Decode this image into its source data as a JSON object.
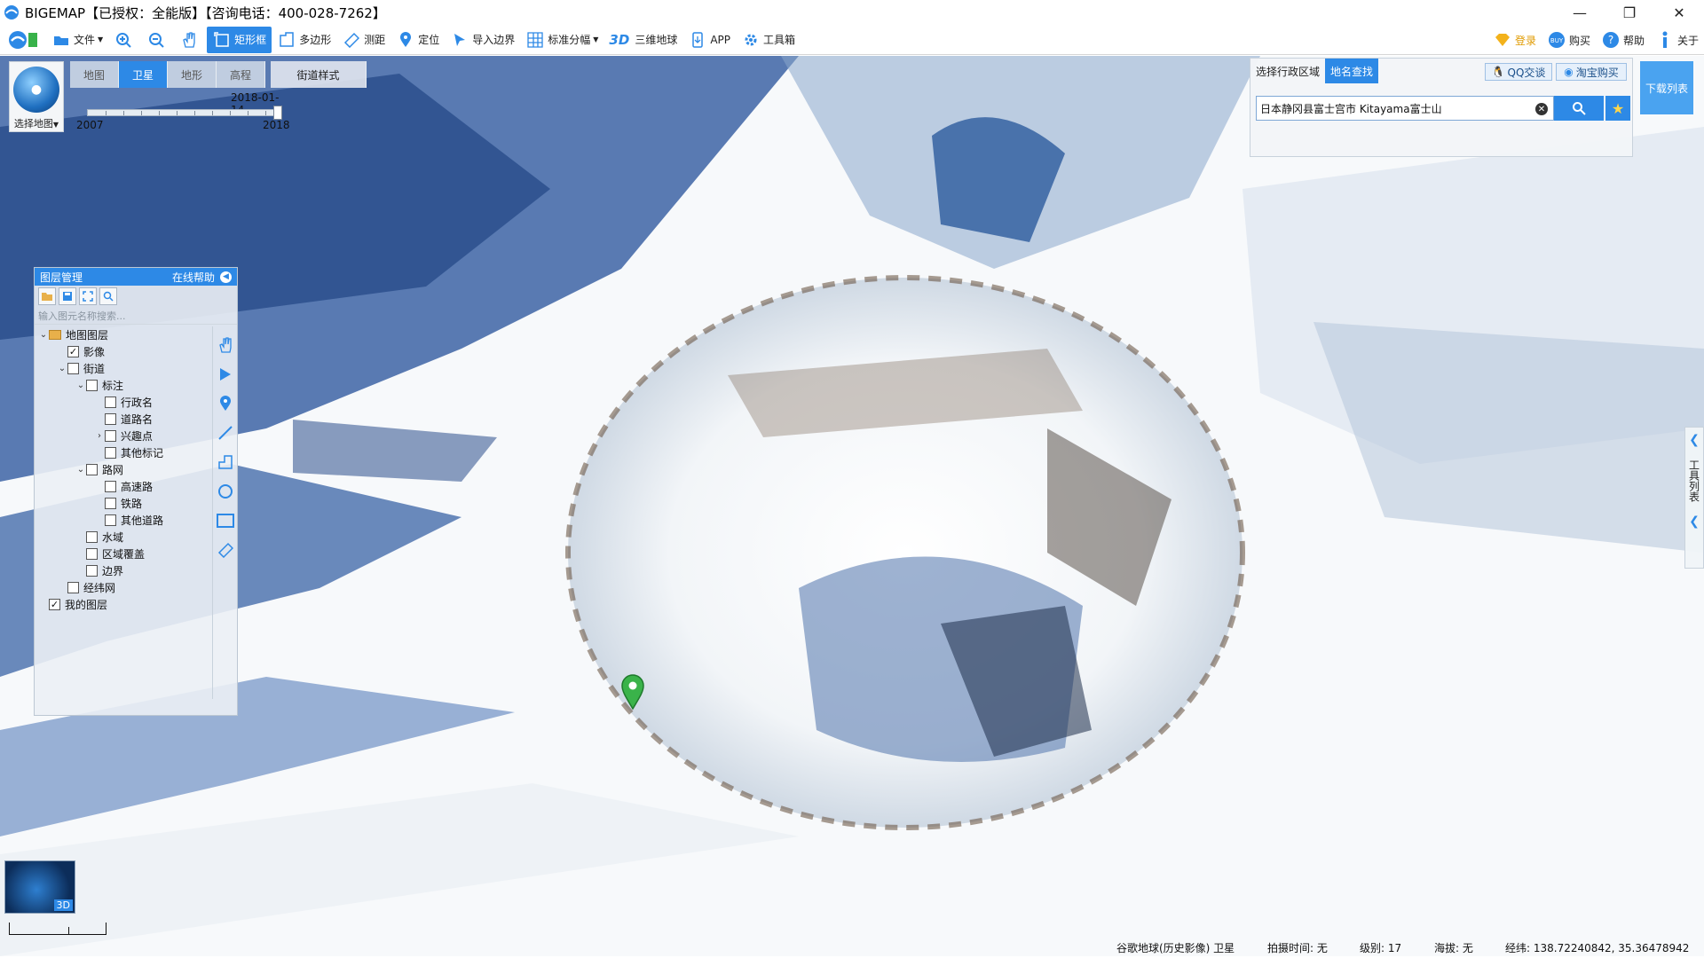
{
  "window": {
    "title": "BIGEMAP【已授权：全能版】【咨询电话：400-028-7262】",
    "minimize": "—",
    "restore": "❐",
    "close": "✕"
  },
  "toolbar": {
    "file": "文件",
    "rect": "矩形框",
    "polygon": "多边形",
    "measure": "测距",
    "locate": "定位",
    "import_boundary": "导入边界",
    "standard_tiles": "标准分幅",
    "three_d": "3D",
    "globe3d": "三维地球",
    "app": "APP",
    "toolbox": "工具箱",
    "login": "登录",
    "buy": "购买",
    "help": "帮助",
    "about": "关于"
  },
  "map_selector": {
    "label": "选择地图"
  },
  "map_types": [
    "地图",
    "卫星",
    "地形",
    "高程"
  ],
  "active_map_type": "卫星",
  "street_style": "街道样式",
  "timeline": {
    "date": "2018-01-14",
    "start": "2007",
    "end": "2018"
  },
  "layer_panel": {
    "title": "图层管理",
    "online_help": "在线帮助",
    "search_placeholder": "输入图元名称搜索...",
    "tree": [
      {
        "label": "地图图层",
        "level": 0,
        "expander": "v",
        "checkbox": false,
        "folder": true
      },
      {
        "label": "影像",
        "level": 1,
        "expander": "",
        "checkbox": true,
        "checked": true
      },
      {
        "label": "街道",
        "level": 1,
        "expander": "v",
        "checkbox": true,
        "checked": false
      },
      {
        "label": "标注",
        "level": 2,
        "expander": "v",
        "checkbox": true,
        "checked": false
      },
      {
        "label": "行政名",
        "level": 3,
        "expander": "",
        "checkbox": true,
        "checked": false
      },
      {
        "label": "道路名",
        "level": 3,
        "expander": "",
        "checkbox": true,
        "checked": false
      },
      {
        "label": "兴趣点",
        "level": 3,
        "expander": ">",
        "checkbox": true,
        "checked": false
      },
      {
        "label": "其他标记",
        "level": 3,
        "expander": "",
        "checkbox": true,
        "checked": false
      },
      {
        "label": "路网",
        "level": 2,
        "expander": "v",
        "checkbox": true,
        "checked": false
      },
      {
        "label": "高速路",
        "level": 3,
        "expander": "",
        "checkbox": true,
        "checked": false
      },
      {
        "label": "铁路",
        "level": 3,
        "expander": "",
        "checkbox": true,
        "checked": false
      },
      {
        "label": "其他道路",
        "level": 3,
        "expander": "",
        "checkbox": true,
        "checked": false
      },
      {
        "label": "水域",
        "level": 2,
        "expander": "",
        "checkbox": true,
        "checked": false
      },
      {
        "label": "区域覆盖",
        "level": 2,
        "expander": "",
        "checkbox": true,
        "checked": false
      },
      {
        "label": "边界",
        "level": 2,
        "expander": "",
        "checkbox": true,
        "checked": false
      },
      {
        "label": "经纬网",
        "level": 1,
        "expander": "",
        "checkbox": true,
        "checked": false
      },
      {
        "label": "我的图层",
        "level": 0,
        "expander": "",
        "checkbox": true,
        "checked": true
      }
    ]
  },
  "search_panel": {
    "tab_region": "选择行政区域",
    "tab_place": "地名查找",
    "qq": "QQ交谈",
    "taobao": "淘宝购买",
    "query": "日本静冈县富士宫市 Kitayama富士山"
  },
  "download_list": "下载列表",
  "right_toolbar": {
    "label": "工具列表"
  },
  "mini_globe": {
    "label": "3D"
  },
  "status": {
    "source": "谷歌地球(历史影像)  卫星",
    "capture_time": "拍摄时间: 无",
    "level": "级别: 17",
    "altitude": "海拔: 无",
    "coords": "经纬: 138.72240842, 35.36478942"
  },
  "colors": {
    "accent": "#2d89e6",
    "toolbar_bg": "#ffffff"
  }
}
